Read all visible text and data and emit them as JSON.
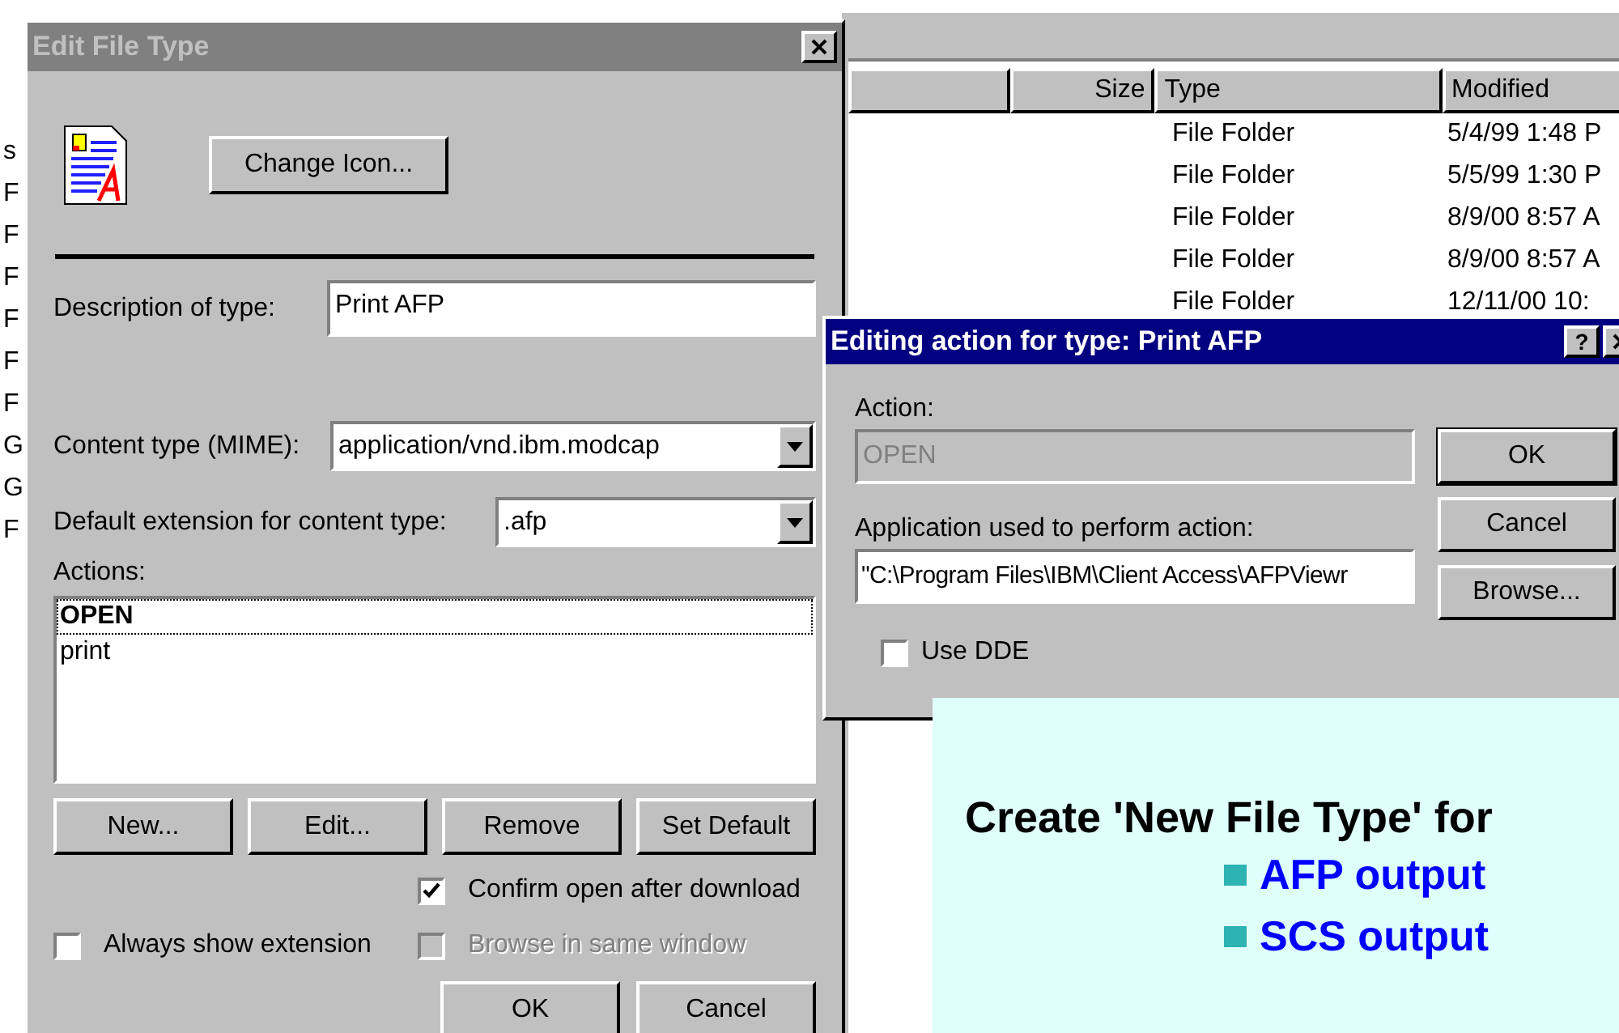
{
  "background_letters": [
    "s",
    "F",
    "F",
    "F",
    "F",
    "F",
    "F",
    "G",
    "G",
    "F"
  ],
  "edit_file_type": {
    "title": "Edit File Type",
    "change_icon_button": "Change Icon...",
    "description_label": "Description of type:",
    "description_value": "Print AFP",
    "content_type_label": "Content type (MIME):",
    "content_type_value": "application/vnd.ibm.modcap",
    "default_extension_label": "Default extension for content type:",
    "default_extension_value": ".afp",
    "actions_label": "Actions:",
    "actions": [
      {
        "label": "OPEN",
        "selected": true,
        "default": true
      },
      {
        "label": "print",
        "selected": false,
        "default": false
      }
    ],
    "action_buttons": [
      "New...",
      "Edit...",
      "Remove",
      "Set Default"
    ],
    "options": [
      {
        "label": "Confirm open after download",
        "checked": true,
        "disabled": false
      },
      {
        "label": "Always show extension",
        "checked": false,
        "disabled": false
      },
      {
        "label": "Browse in same window",
        "checked": false,
        "disabled": true
      }
    ],
    "buttons": [
      "OK",
      "Cancel"
    ]
  },
  "explorer": {
    "columns": [
      "Size",
      "Type",
      "Modified"
    ],
    "rows": [
      {
        "type": "File Folder",
        "modified": "5/4/99 1:48 P"
      },
      {
        "type": "File Folder",
        "modified": "5/5/99 1:30 P"
      },
      {
        "type": "File Folder",
        "modified": "8/9/00 8:57 A"
      },
      {
        "type": "File Folder",
        "modified": "8/9/00 8:57 A"
      },
      {
        "type": "File Folder",
        "modified": "12/11/00 10:"
      }
    ]
  },
  "action_dialog": {
    "title": "Editing action for type: Print AFP",
    "help_button": "?",
    "action_label": "Action:",
    "action_value": "OPEN",
    "action_disabled": true,
    "application_label": "Application used to perform action:",
    "application_value": "\"C:\\Program Files\\IBM\\Client Access\\AFPViewr",
    "buttons": [
      {
        "label": "OK",
        "default": true
      },
      {
        "label": "Cancel",
        "default": false
      },
      {
        "label": "Browse...",
        "default": false
      }
    ],
    "use_dde": {
      "label": "Use DDE",
      "checked": false
    }
  },
  "callout": {
    "heading": "Create 'New File Type' for",
    "bullets": [
      "AFP output",
      "SCS output"
    ]
  }
}
